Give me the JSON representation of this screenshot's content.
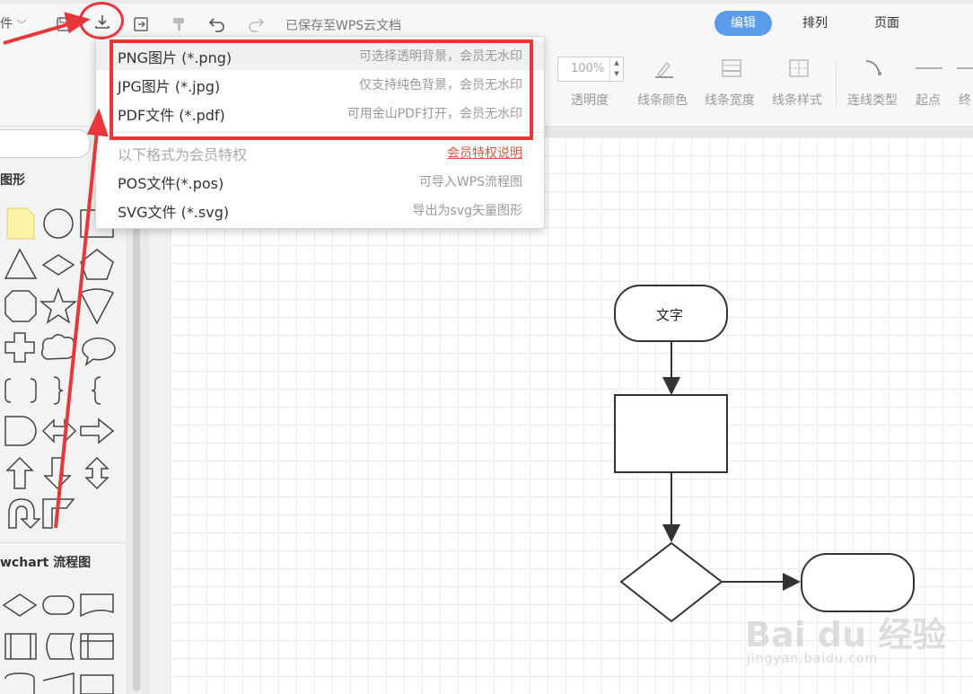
{
  "toolbar": {
    "file_menu": "件",
    "saved_status": "已保存至WPS云文档",
    "mode_tabs": [
      "编辑",
      "排列",
      "页面"
    ],
    "opacity_value": "100%",
    "prop_labels": [
      "透明度",
      "线条颜色",
      "线条宽度",
      "线条样式",
      "连线类型",
      "起点",
      "终"
    ]
  },
  "sidebar": {
    "basic_title": "图形",
    "flowchart_title": "wchart 流程图"
  },
  "export_menu": {
    "items": [
      {
        "label": "PNG图片 (*.png)",
        "desc": "可选择透明背景，会员无水印"
      },
      {
        "label": "JPG图片 (*.jpg)",
        "desc": "仅支持纯色背景，会员无水印"
      },
      {
        "label": "PDF文件 (*.pdf)",
        "desc": "可用金山PDF打开，会员无水印"
      }
    ],
    "member_note": "以下格式为会员特权",
    "member_link": "会员特权说明",
    "member_items": [
      {
        "label": "POS文件(*.pos)",
        "desc": "可导入WPS流程图"
      },
      {
        "label": "SVG文件 (*.svg)",
        "desc": "导出为svg矢量图形"
      }
    ]
  },
  "canvas": {
    "start_text": "文字"
  },
  "watermark": {
    "brand": "Bai du 经验",
    "url": "jingyan.baidu.com"
  },
  "colors": {
    "accent": "#5a9bea",
    "annotation": "#e8373a",
    "link": "#e0533f"
  }
}
